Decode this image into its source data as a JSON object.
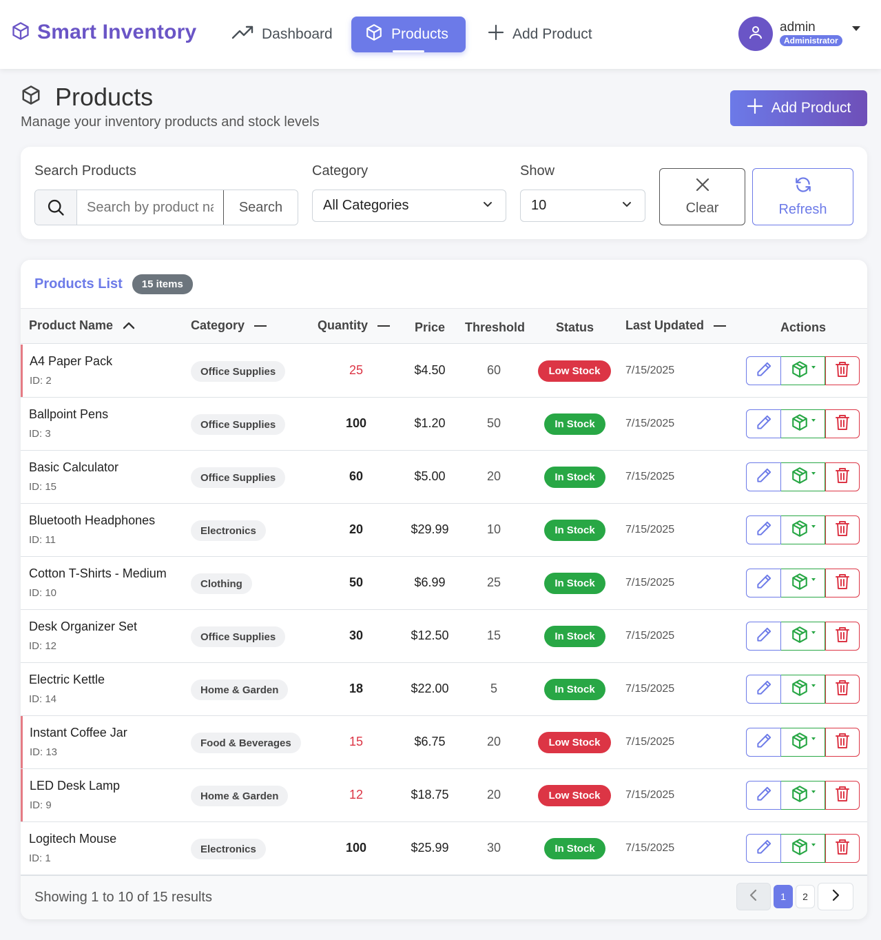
{
  "nav": {
    "brand": "Smart Inventory",
    "items": [
      {
        "label": "Dashboard",
        "icon": "trending-up-icon"
      },
      {
        "label": "Products",
        "icon": "box-icon",
        "active": true
      },
      {
        "label": "Add Product",
        "icon": "plus-icon"
      }
    ],
    "user": {
      "name": "admin",
      "role": "Administrator"
    }
  },
  "header": {
    "title": "Products",
    "subtitle": "Manage your inventory products and stock levels",
    "add_button": "Add Product"
  },
  "filters": {
    "search_label": "Search Products",
    "search_placeholder": "Search by product name...",
    "search_button": "Search",
    "category_label": "Category",
    "category_value": "All Categories",
    "show_label": "Show",
    "show_value": "10",
    "clear_button": "Clear",
    "refresh_button": "Refresh"
  },
  "list": {
    "title": "Products List",
    "count_badge": "15 items",
    "columns": [
      "Product Name",
      "Category",
      "Quantity",
      "Price",
      "Threshold",
      "Status",
      "Last Updated",
      "Actions"
    ],
    "rows": [
      {
        "name": "A4 Paper Pack",
        "id": "ID: 2",
        "category": "Office Supplies",
        "quantity": "25",
        "price": "$4.50",
        "threshold": "60",
        "status": "Low Stock",
        "updated": "7/15/2025",
        "low": true
      },
      {
        "name": "Ballpoint Pens",
        "id": "ID: 3",
        "category": "Office Supplies",
        "quantity": "100",
        "price": "$1.20",
        "threshold": "50",
        "status": "In Stock",
        "updated": "7/15/2025",
        "low": false
      },
      {
        "name": "Basic Calculator",
        "id": "ID: 15",
        "category": "Office Supplies",
        "quantity": "60",
        "price": "$5.00",
        "threshold": "20",
        "status": "In Stock",
        "updated": "7/15/2025",
        "low": false
      },
      {
        "name": "Bluetooth Headphones",
        "id": "ID: 11",
        "category": "Electronics",
        "quantity": "20",
        "price": "$29.99",
        "threshold": "10",
        "status": "In Stock",
        "updated": "7/15/2025",
        "low": false
      },
      {
        "name": "Cotton T-Shirts - Medium",
        "id": "ID: 10",
        "category": "Clothing",
        "quantity": "50",
        "price": "$6.99",
        "threshold": "25",
        "status": "In Stock",
        "updated": "7/15/2025",
        "low": false
      },
      {
        "name": "Desk Organizer Set",
        "id": "ID: 12",
        "category": "Office Supplies",
        "quantity": "30",
        "price": "$12.50",
        "threshold": "15",
        "status": "In Stock",
        "updated": "7/15/2025",
        "low": false
      },
      {
        "name": "Electric Kettle",
        "id": "ID: 14",
        "category": "Home & Garden",
        "quantity": "18",
        "price": "$22.00",
        "threshold": "5",
        "status": "In Stock",
        "updated": "7/15/2025",
        "low": false
      },
      {
        "name": "Instant Coffee Jar",
        "id": "ID: 13",
        "category": "Food & Beverages",
        "quantity": "15",
        "price": "$6.75",
        "threshold": "20",
        "status": "Low Stock",
        "updated": "7/15/2025",
        "low": true
      },
      {
        "name": "LED Desk Lamp",
        "id": "ID: 9",
        "category": "Home & Garden",
        "quantity": "12",
        "price": "$18.75",
        "threshold": "20",
        "status": "Low Stock",
        "updated": "7/15/2025",
        "low": true
      },
      {
        "name": "Logitech Mouse",
        "id": "ID: 1",
        "category": "Electronics",
        "quantity": "100",
        "price": "$25.99",
        "threshold": "30",
        "status": "In Stock",
        "updated": "7/15/2025",
        "low": false
      }
    ]
  },
  "footer": {
    "showing": "Showing 1 to 10 of 15 results",
    "pages": [
      "1",
      "2"
    ],
    "current_page": "1"
  },
  "colors": {
    "brand": "#6a55c6",
    "accent": "#6c7ae8",
    "success": "#28a745",
    "danger": "#dc3545"
  }
}
